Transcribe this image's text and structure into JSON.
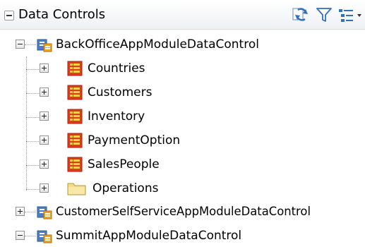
{
  "panel": {
    "title": "Data Controls",
    "header_icons": [
      "refresh-icon",
      "filter-icon",
      "view-options-icon"
    ]
  },
  "tree": {
    "nodes": [
      {
        "label": "BackOfficeAppModuleDataControl",
        "icon": "data-control-icon",
        "expanded": true,
        "children": [
          {
            "label": "Countries",
            "icon": "collection-icon",
            "expanded": false
          },
          {
            "label": "Customers",
            "icon": "collection-icon",
            "expanded": false
          },
          {
            "label": "Inventory",
            "icon": "collection-icon",
            "expanded": false
          },
          {
            "label": "PaymentOption",
            "icon": "collection-icon",
            "expanded": false
          },
          {
            "label": "SalesPeople",
            "icon": "collection-icon",
            "expanded": false
          },
          {
            "label": "Operations",
            "icon": "folder-icon",
            "expanded": false
          }
        ]
      },
      {
        "label": "CustomerSelfServiceAppModuleDataControl",
        "icon": "data-control-icon",
        "expanded": false
      },
      {
        "label": "SummitAppModuleDataControl",
        "icon": "data-control-icon",
        "expanded": true
      }
    ]
  },
  "colors": {
    "collection_red": "#e23b1c",
    "collection_orange": "#f5a623",
    "folder_yellow": "#f3dc88",
    "data_control_blue": "#4a7fc4",
    "data_control_orange": "#f0a31f"
  }
}
